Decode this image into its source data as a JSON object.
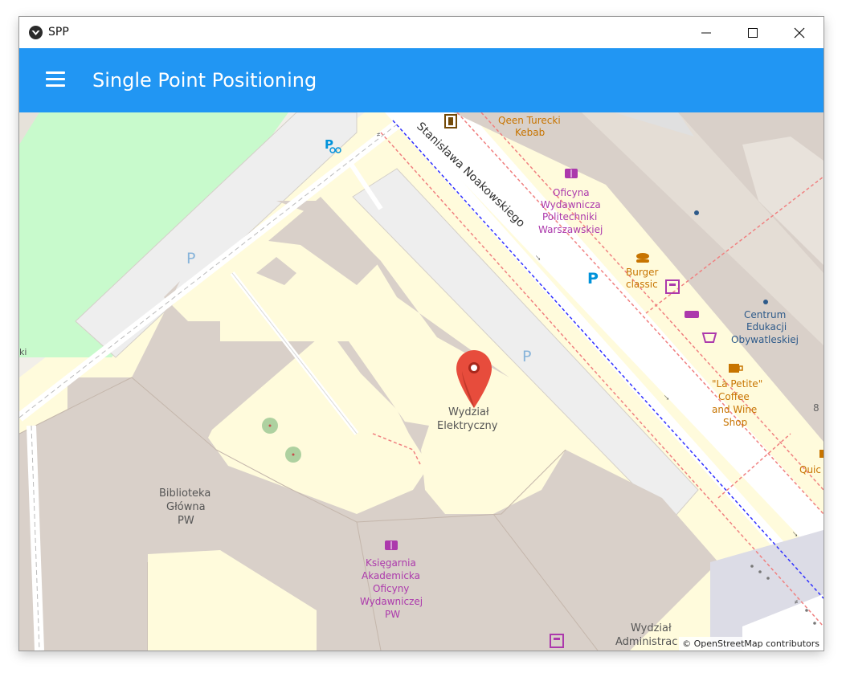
{
  "window": {
    "title": "SPP"
  },
  "appbar": {
    "title": "Single Point Positioning"
  },
  "map": {
    "labels": {
      "street": "Stanisława Noakowskiego",
      "qeen_turecki": "Qeen Turecki",
      "kebab": "Kebab",
      "oficyna_1": "Oficyna",
      "oficyna_2": "Wydawnicza",
      "oficyna_3": "Politechniki",
      "oficyna_4": "Warszawskiej",
      "burger_1": "Burger",
      "burger_2": "classic",
      "centrum_1": "Centrum",
      "centrum_2": "Edukacji",
      "centrum_3": "Obywatleskiej",
      "petite_1": "\"La Petite\"",
      "petite_2": "Coffee",
      "petite_3": "and Wine",
      "petite_4": "Shop",
      "wydzial_1": "Wydział",
      "wydzial_2": "Elektryczny",
      "biblioteka_1": "Biblioteka",
      "biblioteka_2": "Główna",
      "biblioteka_3": "PW",
      "ksiegarnia_1": "Księgarnia",
      "ksiegarnia_2": "Akademicka",
      "ksiegarnia_3": "Oficyny",
      "ksiegarnia_4": "Wydawniczej",
      "ksiegarnia_5": "PW",
      "admin_1": "Wydział",
      "admin_2": "Administrac",
      "quic": "Quic",
      "ki": "ki",
      "eight": "8",
      "parking_1": "P",
      "parking_2": "P",
      "parking_3": "P",
      "bike_parking": "P"
    },
    "marker": {
      "name": "map-pin-icon",
      "color": "#e74c3c"
    },
    "attribution": "© OpenStreetMap contributors"
  },
  "colors": {
    "appbar": "#2196f3",
    "building": "#d9d0c9",
    "park": "#c8facc",
    "campus": "#fffbdc",
    "parking": "#eeeeee",
    "poi_purple": "#ac39ac",
    "poi_brown": "#c77400"
  }
}
